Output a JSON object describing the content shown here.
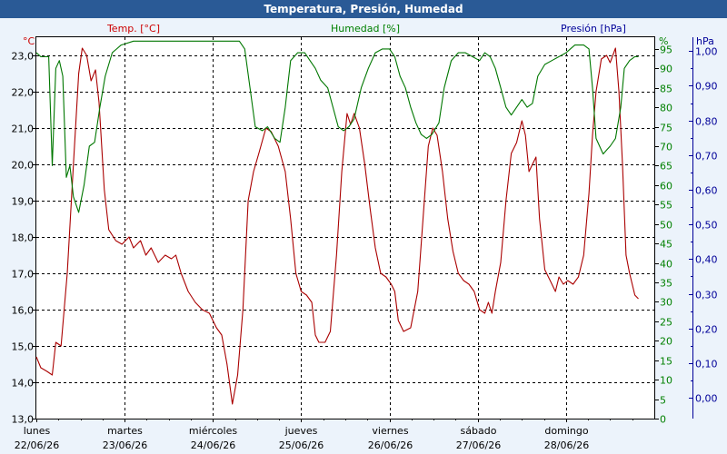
{
  "chart_data": {
    "type": "line",
    "title": "Temperatura, Presión, Humedad",
    "x_categories": [
      {
        "day": "lunes",
        "date": "22/06/26"
      },
      {
        "day": "martes",
        "date": "23/06/26"
      },
      {
        "day": "miércoles",
        "date": "24/06/26"
      },
      {
        "day": "jueves",
        "date": "25/06/26"
      },
      {
        "day": "viernes",
        "date": "26/06/26"
      },
      {
        "day": "sábado",
        "date": "27/06/26"
      },
      {
        "day": "domingo",
        "date": "28/06/26"
      }
    ],
    "x_range": [
      0,
      7
    ],
    "axes": {
      "temp": {
        "unit": "°C",
        "label": "Temp. [°C]",
        "range": [
          13,
          23.5
        ],
        "ticks": [
          13,
          14,
          15,
          16,
          17,
          18,
          19,
          20,
          21,
          22,
          23
        ],
        "decimals": 1,
        "color": "#cc0000"
      },
      "humidity": {
        "unit": "%",
        "label": "Humedad [%]",
        "range": [
          0,
          98
        ],
        "ticks": [
          0,
          5,
          10,
          15,
          20,
          25,
          30,
          35,
          40,
          45,
          50,
          55,
          60,
          65,
          70,
          75,
          80,
          85,
          90,
          95
        ],
        "decimals": 0,
        "color": "#008000"
      },
      "pressure": {
        "unit": "hPa",
        "label": "Presión [hPa]",
        "range": [
          -0.06,
          1.04
        ],
        "ticks": [
          0,
          0.1,
          0.2,
          0.3,
          0.4,
          0.5,
          0.6,
          0.7,
          0.8,
          0.9,
          1.0
        ],
        "decimals": 2,
        "color": "#000099"
      }
    },
    "grid": true,
    "series": [
      {
        "name": "Temp. [°C]",
        "axis": "temp",
        "color": "#aa0000",
        "points": [
          [
            0,
            14.7
          ],
          [
            0.05,
            14.4
          ],
          [
            0.12,
            14.3
          ],
          [
            0.18,
            14.2
          ],
          [
            0.22,
            15.1
          ],
          [
            0.28,
            15.0
          ],
          [
            0.35,
            17.0
          ],
          [
            0.42,
            20.0
          ],
          [
            0.48,
            22.5
          ],
          [
            0.52,
            23.2
          ],
          [
            0.57,
            23.0
          ],
          [
            0.62,
            22.3
          ],
          [
            0.67,
            22.6
          ],
          [
            0.71,
            21.7
          ],
          [
            0.77,
            19.3
          ],
          [
            0.82,
            18.2
          ],
          [
            0.9,
            17.9
          ],
          [
            0.97,
            17.8
          ],
          [
            1.05,
            18.0
          ],
          [
            1.1,
            17.7
          ],
          [
            1.18,
            17.9
          ],
          [
            1.24,
            17.5
          ],
          [
            1.3,
            17.7
          ],
          [
            1.38,
            17.3
          ],
          [
            1.46,
            17.5
          ],
          [
            1.53,
            17.4
          ],
          [
            1.58,
            17.5
          ],
          [
            1.64,
            17.0
          ],
          [
            1.72,
            16.5
          ],
          [
            1.8,
            16.2
          ],
          [
            1.88,
            16.0
          ],
          [
            1.96,
            15.9
          ],
          [
            2.04,
            15.5
          ],
          [
            2.1,
            15.3
          ],
          [
            2.16,
            14.5
          ],
          [
            2.22,
            13.4
          ],
          [
            2.28,
            14.2
          ],
          [
            2.34,
            16.0
          ],
          [
            2.4,
            19.0
          ],
          [
            2.46,
            19.8
          ],
          [
            2.52,
            20.3
          ],
          [
            2.6,
            21.0
          ],
          [
            2.66,
            20.9
          ],
          [
            2.74,
            20.5
          ],
          [
            2.82,
            19.8
          ],
          [
            2.88,
            18.5
          ],
          [
            2.94,
            17.0
          ],
          [
            3.0,
            16.5
          ],
          [
            3.06,
            16.4
          ],
          [
            3.12,
            16.2
          ],
          [
            3.16,
            15.3
          ],
          [
            3.2,
            15.1
          ],
          [
            3.27,
            15.1
          ],
          [
            3.33,
            15.4
          ],
          [
            3.4,
            17.5
          ],
          [
            3.46,
            19.8
          ],
          [
            3.52,
            21.4
          ],
          [
            3.56,
            21.1
          ],
          [
            3.6,
            21.4
          ],
          [
            3.66,
            21.0
          ],
          [
            3.72,
            20.0
          ],
          [
            3.78,
            18.8
          ],
          [
            3.84,
            17.7
          ],
          [
            3.9,
            17.0
          ],
          [
            3.96,
            16.9
          ],
          [
            4.02,
            16.7
          ],
          [
            4.06,
            16.5
          ],
          [
            4.1,
            15.7
          ],
          [
            4.16,
            15.4
          ],
          [
            4.24,
            15.5
          ],
          [
            4.32,
            16.5
          ],
          [
            4.38,
            18.5
          ],
          [
            4.44,
            20.5
          ],
          [
            4.49,
            21.0
          ],
          [
            4.54,
            20.8
          ],
          [
            4.6,
            19.8
          ],
          [
            4.66,
            18.5
          ],
          [
            4.72,
            17.6
          ],
          [
            4.78,
            17.0
          ],
          [
            4.84,
            16.8
          ],
          [
            4.9,
            16.7
          ],
          [
            4.96,
            16.5
          ],
          [
            5.02,
            16.0
          ],
          [
            5.08,
            15.9
          ],
          [
            5.12,
            16.2
          ],
          [
            5.16,
            15.9
          ],
          [
            5.2,
            16.5
          ],
          [
            5.26,
            17.3
          ],
          [
            5.32,
            19.0
          ],
          [
            5.38,
            20.3
          ],
          [
            5.44,
            20.6
          ],
          [
            5.5,
            21.2
          ],
          [
            5.54,
            20.8
          ],
          [
            5.58,
            19.8
          ],
          [
            5.62,
            20.0
          ],
          [
            5.66,
            20.2
          ],
          [
            5.7,
            18.5
          ],
          [
            5.76,
            17.1
          ],
          [
            5.82,
            16.8
          ],
          [
            5.88,
            16.5
          ],
          [
            5.92,
            16.9
          ],
          [
            5.97,
            16.7
          ],
          [
            6.02,
            16.8
          ],
          [
            6.08,
            16.7
          ],
          [
            6.14,
            16.9
          ],
          [
            6.2,
            17.5
          ],
          [
            6.26,
            19.2
          ],
          [
            6.3,
            20.8
          ],
          [
            6.34,
            22.0
          ],
          [
            6.4,
            22.9
          ],
          [
            6.46,
            23.0
          ],
          [
            6.5,
            22.8
          ],
          [
            6.56,
            23.2
          ],
          [
            6.6,
            22.0
          ],
          [
            6.64,
            20.0
          ],
          [
            6.68,
            17.5
          ],
          [
            6.72,
            17.0
          ],
          [
            6.78,
            16.4
          ],
          [
            6.82,
            16.3
          ]
        ]
      },
      {
        "name": "Humedad [%]",
        "axis": "humidity",
        "color": "#007700",
        "points": [
          [
            0,
            94
          ],
          [
            0.05,
            93
          ],
          [
            0.1,
            93
          ],
          [
            0.14,
            93
          ],
          [
            0.18,
            65
          ],
          [
            0.22,
            90
          ],
          [
            0.26,
            92
          ],
          [
            0.3,
            88
          ],
          [
            0.34,
            62
          ],
          [
            0.38,
            65
          ],
          [
            0.42,
            57
          ],
          [
            0.48,
            53
          ],
          [
            0.54,
            60
          ],
          [
            0.6,
            70
          ],
          [
            0.66,
            71
          ],
          [
            0.72,
            80
          ],
          [
            0.78,
            88
          ],
          [
            0.86,
            94
          ],
          [
            0.96,
            96
          ],
          [
            1.1,
            97
          ],
          [
            1.3,
            97
          ],
          [
            1.5,
            97
          ],
          [
            1.7,
            97
          ],
          [
            1.9,
            97
          ],
          [
            2.1,
            97
          ],
          [
            2.3,
            97
          ],
          [
            2.36,
            95
          ],
          [
            2.42,
            85
          ],
          [
            2.48,
            75
          ],
          [
            2.56,
            74
          ],
          [
            2.62,
            75
          ],
          [
            2.7,
            72
          ],
          [
            2.76,
            71
          ],
          [
            2.82,
            80
          ],
          [
            2.88,
            92
          ],
          [
            2.96,
            94
          ],
          [
            3.04,
            94
          ],
          [
            3.1,
            92
          ],
          [
            3.16,
            90
          ],
          [
            3.22,
            87
          ],
          [
            3.3,
            85
          ],
          [
            3.36,
            80
          ],
          [
            3.42,
            75
          ],
          [
            3.48,
            74
          ],
          [
            3.54,
            75
          ],
          [
            3.6,
            77
          ],
          [
            3.68,
            85
          ],
          [
            3.76,
            90
          ],
          [
            3.84,
            94
          ],
          [
            3.92,
            95
          ],
          [
            4.0,
            95
          ],
          [
            4.06,
            93
          ],
          [
            4.12,
            88
          ],
          [
            4.18,
            85
          ],
          [
            4.24,
            80
          ],
          [
            4.3,
            76
          ],
          [
            4.36,
            73
          ],
          [
            4.42,
            72
          ],
          [
            4.48,
            73
          ],
          [
            4.56,
            76
          ],
          [
            4.62,
            85
          ],
          [
            4.7,
            92
          ],
          [
            4.78,
            94
          ],
          [
            4.86,
            94
          ],
          [
            4.94,
            93
          ],
          [
            5.02,
            92
          ],
          [
            5.08,
            94
          ],
          [
            5.14,
            93
          ],
          [
            5.2,
            90
          ],
          [
            5.26,
            85
          ],
          [
            5.32,
            80
          ],
          [
            5.38,
            78
          ],
          [
            5.44,
            80
          ],
          [
            5.5,
            82
          ],
          [
            5.56,
            80
          ],
          [
            5.62,
            81
          ],
          [
            5.68,
            88
          ],
          [
            5.76,
            91
          ],
          [
            5.84,
            92
          ],
          [
            5.92,
            93
          ],
          [
            6.0,
            94
          ],
          [
            6.1,
            96
          ],
          [
            6.2,
            96
          ],
          [
            6.26,
            95
          ],
          [
            6.3,
            85
          ],
          [
            6.34,
            72
          ],
          [
            6.38,
            70
          ],
          [
            6.42,
            68
          ],
          [
            6.46,
            69
          ],
          [
            6.5,
            70
          ],
          [
            6.56,
            72
          ],
          [
            6.62,
            80
          ],
          [
            6.66,
            90
          ],
          [
            6.72,
            92
          ],
          [
            6.78,
            93
          ],
          [
            6.82,
            93
          ]
        ]
      }
    ]
  }
}
